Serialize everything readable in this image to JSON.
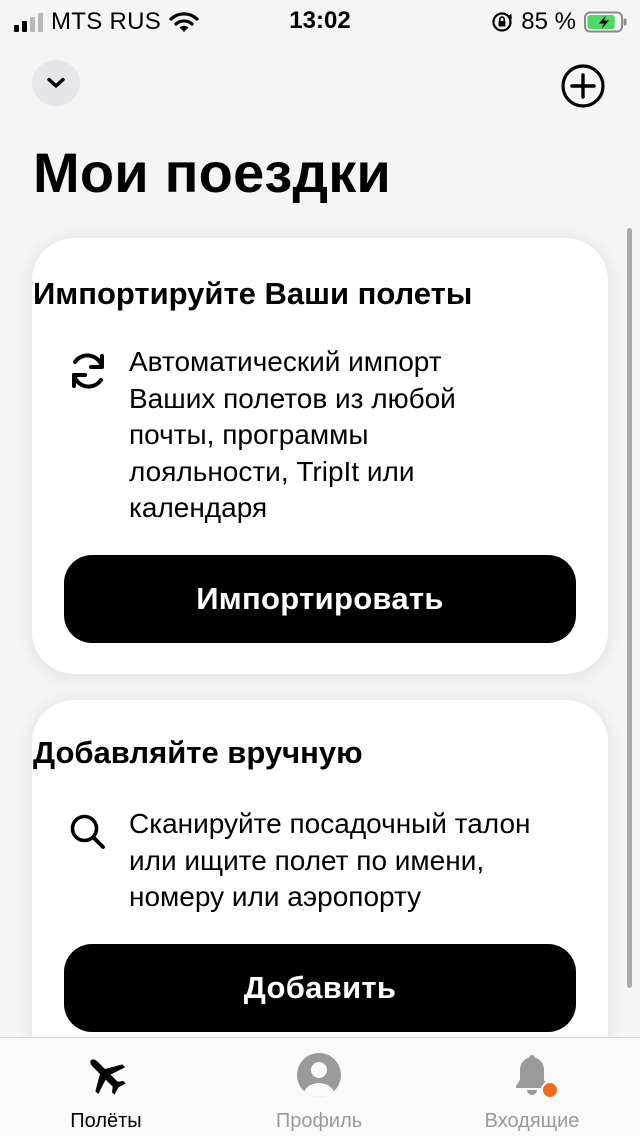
{
  "status_bar": {
    "carrier": "MTS RUS",
    "time": "13:02",
    "battery_percent": "85 %",
    "battery_level": 0.85
  },
  "header": {
    "title": "Мои поездки",
    "collapse_icon": "chevron-down-icon",
    "add_icon": "plus-circle-icon"
  },
  "cards": {
    "import": {
      "title": "Импортируйте Ваши полеты",
      "icon": "sync-icon",
      "description": "Автоматический импорт Ваших полетов из любой почты, программы лояльности, TripIt или календаря",
      "button_label": "Импортировать"
    },
    "manual": {
      "title": "Добавляйте вручную",
      "icon": "search-icon",
      "description": "Сканируйте посадочный талон или ищите полет по имени, номеру или аэропорту",
      "button_label": "Добавить"
    }
  },
  "tab_bar": {
    "tabs": [
      {
        "label": "Полёты",
        "icon": "airplane-icon",
        "active": true
      },
      {
        "label": "Профиль",
        "icon": "user-icon",
        "active": false
      },
      {
        "label": "Входящие",
        "icon": "bell-icon",
        "active": false
      }
    ]
  },
  "colors": {
    "background": "#f5f5f5",
    "card": "#ffffff",
    "button": "#000000",
    "inactive": "#9a9a9a",
    "badge": "#f26a1b",
    "battery": "#4cd964"
  }
}
